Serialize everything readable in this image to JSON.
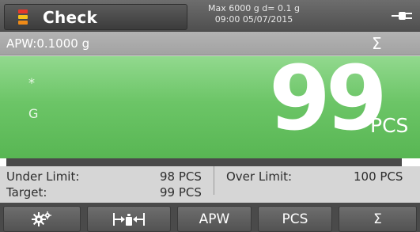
{
  "header": {
    "mode_label": "Check",
    "mode_icon": "check-weighing-icon",
    "capacity": "Max 6000 g  d= 0.1 g",
    "datetime": "09:00   05/07/2015",
    "power_icon": "power-plug-icon"
  },
  "info_bar": {
    "apw": "APW:0.1000 g",
    "sigma": "Σ"
  },
  "display": {
    "stable_indicator": "*",
    "mode_indicator": "G",
    "value": "99",
    "unit": "PCS"
  },
  "limits": {
    "under_label": "Under Limit:",
    "under_value": "98 PCS",
    "over_label": "Over Limit:",
    "over_value": "100 PCS",
    "target_label": "Target:",
    "target_value": "99 PCS"
  },
  "capacity_bar": {
    "fill_fraction": 0.97
  },
  "softkeys": [
    {
      "label": "",
      "icon": "settings-gears-icon"
    },
    {
      "label": "",
      "icon": "tare-icon"
    },
    {
      "label": "APW",
      "icon": ""
    },
    {
      "label": "PCS",
      "icon": ""
    },
    {
      "label": "Σ",
      "icon": ""
    }
  ],
  "colors": {
    "display_green": "#6cc567",
    "titlebar": "#5a5a5a",
    "info_bar": "#a8a8a8"
  }
}
